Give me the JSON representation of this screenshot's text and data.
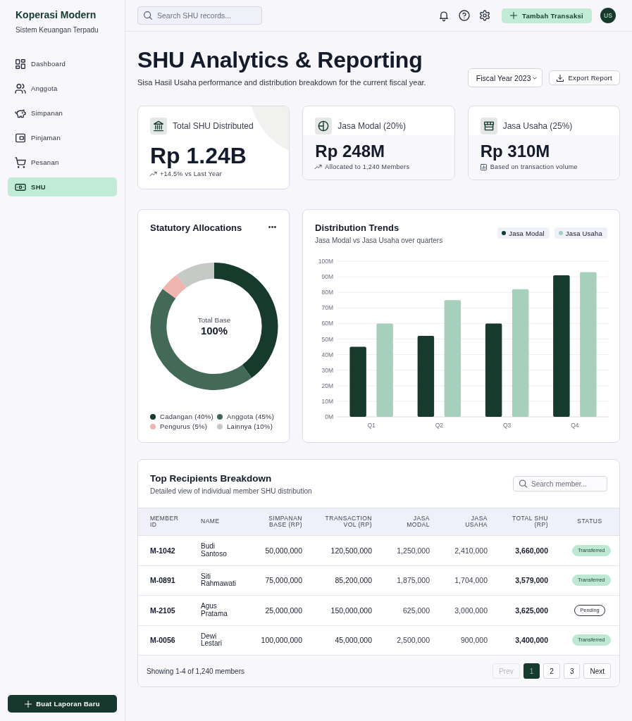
{
  "sidebar": {
    "brand": "Koperasi Modern",
    "tagline": "Sistem Keuangan Terpadu",
    "items": [
      {
        "label": "Dashboard",
        "selected": false
      },
      {
        "label": "Anggota",
        "selected": false
      },
      {
        "label": "Simpanan",
        "selected": false
      },
      {
        "label": "Pinjaman",
        "selected": false
      },
      {
        "label": "Pesanan",
        "selected": false
      },
      {
        "label": "SHU",
        "selected": true
      }
    ],
    "action_button": "Buat Laporan Baru"
  },
  "header": {
    "search": {
      "placeholder": "Search SHU records..."
    },
    "primary_button": "Tambah Transaksi",
    "avatar": "US"
  },
  "page": {
    "title": "SHU Analytics & Reporting",
    "subtitle": "Sisa Hasil Usaha performance and distribution breakdown for the current fiscal year.",
    "period_select": {
      "value": "Fiscal Year 2023"
    },
    "export_button": "Export Report"
  },
  "stats": [
    {
      "kind": "hero",
      "label": "Total SHU Distributed",
      "value": "Rp 1.24B",
      "note": "+14.5% vs Last Year"
    },
    {
      "kind": "split",
      "label": "Jasa Modal (20%)",
      "value": "Rp 248M",
      "note": "Allocated to 1,240 Members"
    },
    {
      "kind": "split",
      "label": "Jasa Usaha (25%)",
      "value": "Rp 310M",
      "note": "Based on transaction volume"
    }
  ],
  "allocations": {
    "title": "Statutory Allocations",
    "center_label": "Total Base",
    "center_value": "100%",
    "chart_data": {
      "type": "donut",
      "categories": [
        "Cadangan (40%)",
        "Anggota (45%)",
        "Pengurus (5%)",
        "Lainnya (10%)"
      ],
      "values": [
        40,
        45,
        5,
        10
      ]
    },
    "slices": [
      {
        "color": "#163a2c"
      },
      {
        "color": "#426a57"
      },
      {
        "color": "#f0b5ae"
      },
      {
        "color": "#c5cac7"
      }
    ]
  },
  "trends": {
    "title": "Distribution Trends",
    "subtitle": "Jasa Modal vs Jasa Usaha over quarters",
    "chart_data": {
      "type": "bar",
      "categories": [
        "Q1",
        "Q2",
        "Q3",
        "Q4"
      ],
      "series": [
        {
          "name": "Jasa Modal",
          "color": "#163a2c",
          "values": [
            45,
            52,
            60,
            91
          ]
        },
        {
          "name": "Jasa Usaha",
          "color": "#a6cfbc",
          "values": [
            60,
            75,
            82,
            93
          ]
        }
      ],
      "ylim": [
        0,
        100
      ],
      "grid": true,
      "yticks": [
        {
          "value": 0,
          "label": "0M"
        },
        {
          "value": 10,
          "label": "10M"
        },
        {
          "value": 20,
          "label": "20M"
        },
        {
          "value": 30,
          "label": "30M"
        },
        {
          "value": 40,
          "label": "40M"
        },
        {
          "value": 50,
          "label": "50M"
        },
        {
          "value": 60,
          "label": "60M"
        },
        {
          "value": 70,
          "label": "70M"
        },
        {
          "value": 80,
          "label": "80M"
        },
        {
          "value": 90,
          "label": "90M"
        },
        {
          "value": 100,
          "label": "100M"
        }
      ]
    }
  },
  "recipients": {
    "title": "Top Recipients Breakdown",
    "subtitle": "Detailed view of individual member SHU distribution",
    "search": {
      "placeholder": "Search member..."
    },
    "columns": [
      "MEMBER ID",
      "NAME",
      "SIMPANAN BASE (RP)",
      "TRANSACTION VOL (RP)",
      "JASA MODAL",
      "JASA USAHA",
      "TOTAL SHU (RP)",
      "STATUS"
    ],
    "rows": [
      {
        "member_id": "M-1042",
        "name": "Budi Santoso",
        "simpanan_base": "50,000,000",
        "transaction_vol": "120,500,000",
        "jasa_modal": "1,250,000",
        "jasa_usaha": "2,410,000",
        "total_shu": "3,660,000",
        "status": {
          "label": "Transferred",
          "kind": "transferred"
        }
      },
      {
        "member_id": "M-0891",
        "name": "Siti Rahmawati",
        "simpanan_base": "75,000,000",
        "transaction_vol": "85,200,000",
        "jasa_modal": "1,875,000",
        "jasa_usaha": "1,704,000",
        "total_shu": "3,579,000",
        "status": {
          "label": "Transferred",
          "kind": "transferred"
        }
      },
      {
        "member_id": "M-2105",
        "name": "Agus Pratama",
        "simpanan_base": "25,000,000",
        "transaction_vol": "150,000,000",
        "jasa_modal": "625,000",
        "jasa_usaha": "3,000,000",
        "total_shu": "3,625,000",
        "status": {
          "label": "Pending",
          "kind": "pending"
        }
      },
      {
        "member_id": "M-0056",
        "name": "Dewi Lestari",
        "simpanan_base": "100,000,000",
        "transaction_vol": "45,000,000",
        "jasa_modal": "2,500,000",
        "jasa_usaha": "900,000",
        "total_shu": "3,400,000",
        "status": {
          "label": "Transferred",
          "kind": "transferred"
        }
      }
    ],
    "footer": "Showing 1-4 of 1,240 members",
    "pagination": {
      "prev": {
        "label": "Prev",
        "disabled": true
      },
      "pages": [
        {
          "label": "1",
          "selected": true
        },
        {
          "label": "2",
          "selected": false
        },
        {
          "label": "3",
          "selected": false
        }
      ],
      "next": {
        "label": "Next",
        "disabled": false
      }
    }
  }
}
